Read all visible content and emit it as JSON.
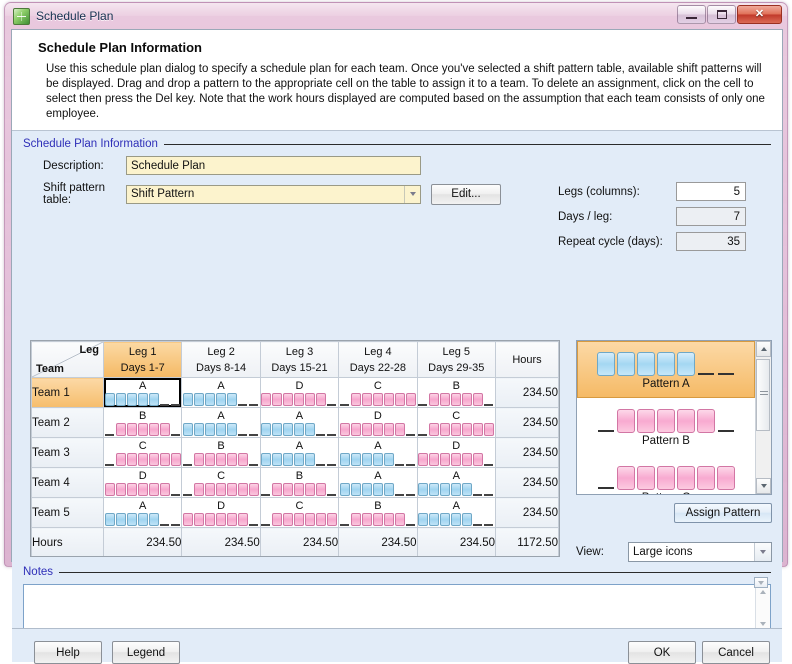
{
  "window": {
    "title": "Schedule Plan",
    "icon": "spreadsheet-icon",
    "minimize_label": "Minimize",
    "maximize_label": "Maximize",
    "close_label": "✕"
  },
  "header": {
    "title": "Schedule Plan Information",
    "description": "Use this schedule plan dialog to specify a schedule plan for each team. Once you've selected a shift pattern table, available shift patterns will be displayed. Drag and drop a pattern to the appropriate cell on the table to assign it to a team. To delete an assignment, click on the cell to select then press the Del key. Note that the work hours displayed are computed based on the assumption that each team consists of only one employee."
  },
  "group": {
    "info_label": "Schedule Plan Information",
    "notes_label": "Notes"
  },
  "form": {
    "description_label": "Description:",
    "description_value": "Schedule Plan",
    "shift_pattern_label": "Shift pattern table:",
    "shift_pattern_value": "Shift Pattern",
    "edit_label": "Edit...",
    "legs_label": "Legs (columns):",
    "legs_value": "5",
    "days_per_leg_label": "Days / leg:",
    "days_per_leg_value": "7",
    "repeat_cycle_label": "Repeat cycle (days):",
    "repeat_cycle_value": "35"
  },
  "table": {
    "corner_leg": "Leg",
    "corner_team": "Team",
    "hours_header": "Hours",
    "hours_row_label": "Hours",
    "columns": [
      {
        "name": "Leg 1",
        "days": "Days 1-7",
        "selected": true
      },
      {
        "name": "Leg 2",
        "days": "Days 8-14",
        "selected": false
      },
      {
        "name": "Leg 3",
        "days": "Days 15-21",
        "selected": false
      },
      {
        "name": "Leg 4",
        "days": "Days 22-28",
        "selected": false
      },
      {
        "name": "Leg 5",
        "days": "Days 29-35",
        "selected": false
      }
    ],
    "rows": [
      {
        "team": "Team 1",
        "selected": true,
        "cells": [
          "A",
          "A",
          "D",
          "C",
          "B"
        ],
        "hours": "234.50"
      },
      {
        "team": "Team 2",
        "selected": false,
        "cells": [
          "B",
          "A",
          "A",
          "D",
          "C"
        ],
        "hours": "234.50"
      },
      {
        "team": "Team 3",
        "selected": false,
        "cells": [
          "C",
          "B",
          "A",
          "A",
          "D"
        ],
        "hours": "234.50"
      },
      {
        "team": "Team 4",
        "selected": false,
        "cells": [
          "D",
          "C",
          "B",
          "A",
          "A"
        ],
        "hours": "234.50"
      },
      {
        "team": "Team 5",
        "selected": false,
        "cells": [
          "A",
          "D",
          "C",
          "B",
          "A"
        ],
        "hours": "234.50"
      }
    ],
    "column_hours": [
      "234.50",
      "234.50",
      "234.50",
      "234.50",
      "234.50"
    ],
    "total_hours": "1172.50",
    "selected_cell": {
      "row": 0,
      "column": 0
    },
    "pattern_shapes": {
      "A": [
        "blue",
        "blue",
        "blue",
        "blue",
        "blue",
        "gap",
        "gap"
      ],
      "B": [
        "gap",
        "pink",
        "pink",
        "pink",
        "pink",
        "pink",
        "gap"
      ],
      "C": [
        "gap",
        "pink",
        "pink",
        "pink",
        "pink",
        "pink",
        "pink"
      ],
      "D": [
        "pink",
        "pink",
        "pink",
        "pink",
        "pink",
        "pink",
        "gap"
      ]
    }
  },
  "palette": {
    "items": [
      {
        "label": "Pattern A",
        "selected": true,
        "shape": [
          "blue",
          "blue",
          "blue",
          "blue",
          "blue",
          "gap",
          "gap"
        ]
      },
      {
        "label": "Pattern B",
        "selected": false,
        "shape": [
          "gap",
          "pink",
          "pink",
          "pink",
          "pink",
          "pink",
          "gap"
        ]
      },
      {
        "label": "Pattern C",
        "selected": false,
        "shape": [
          "gap",
          "pink",
          "pink",
          "pink",
          "pink",
          "pink",
          "pink"
        ]
      }
    ],
    "assign_label": "Assign Pattern",
    "view_label": "View:",
    "view_value": "Large icons"
  },
  "notes": {
    "value": ""
  },
  "footer": {
    "help_label": "Help",
    "legend_label": "Legend",
    "ok_label": "OK",
    "cancel_label": "Cancel"
  },
  "colors": {
    "blue_block": "#9fd4f0",
    "pink_block": "#f7a6cd",
    "selection_orange": "#f5b964",
    "group_label": "#2f2fb8",
    "panel_bg": "#e2ecf8"
  }
}
